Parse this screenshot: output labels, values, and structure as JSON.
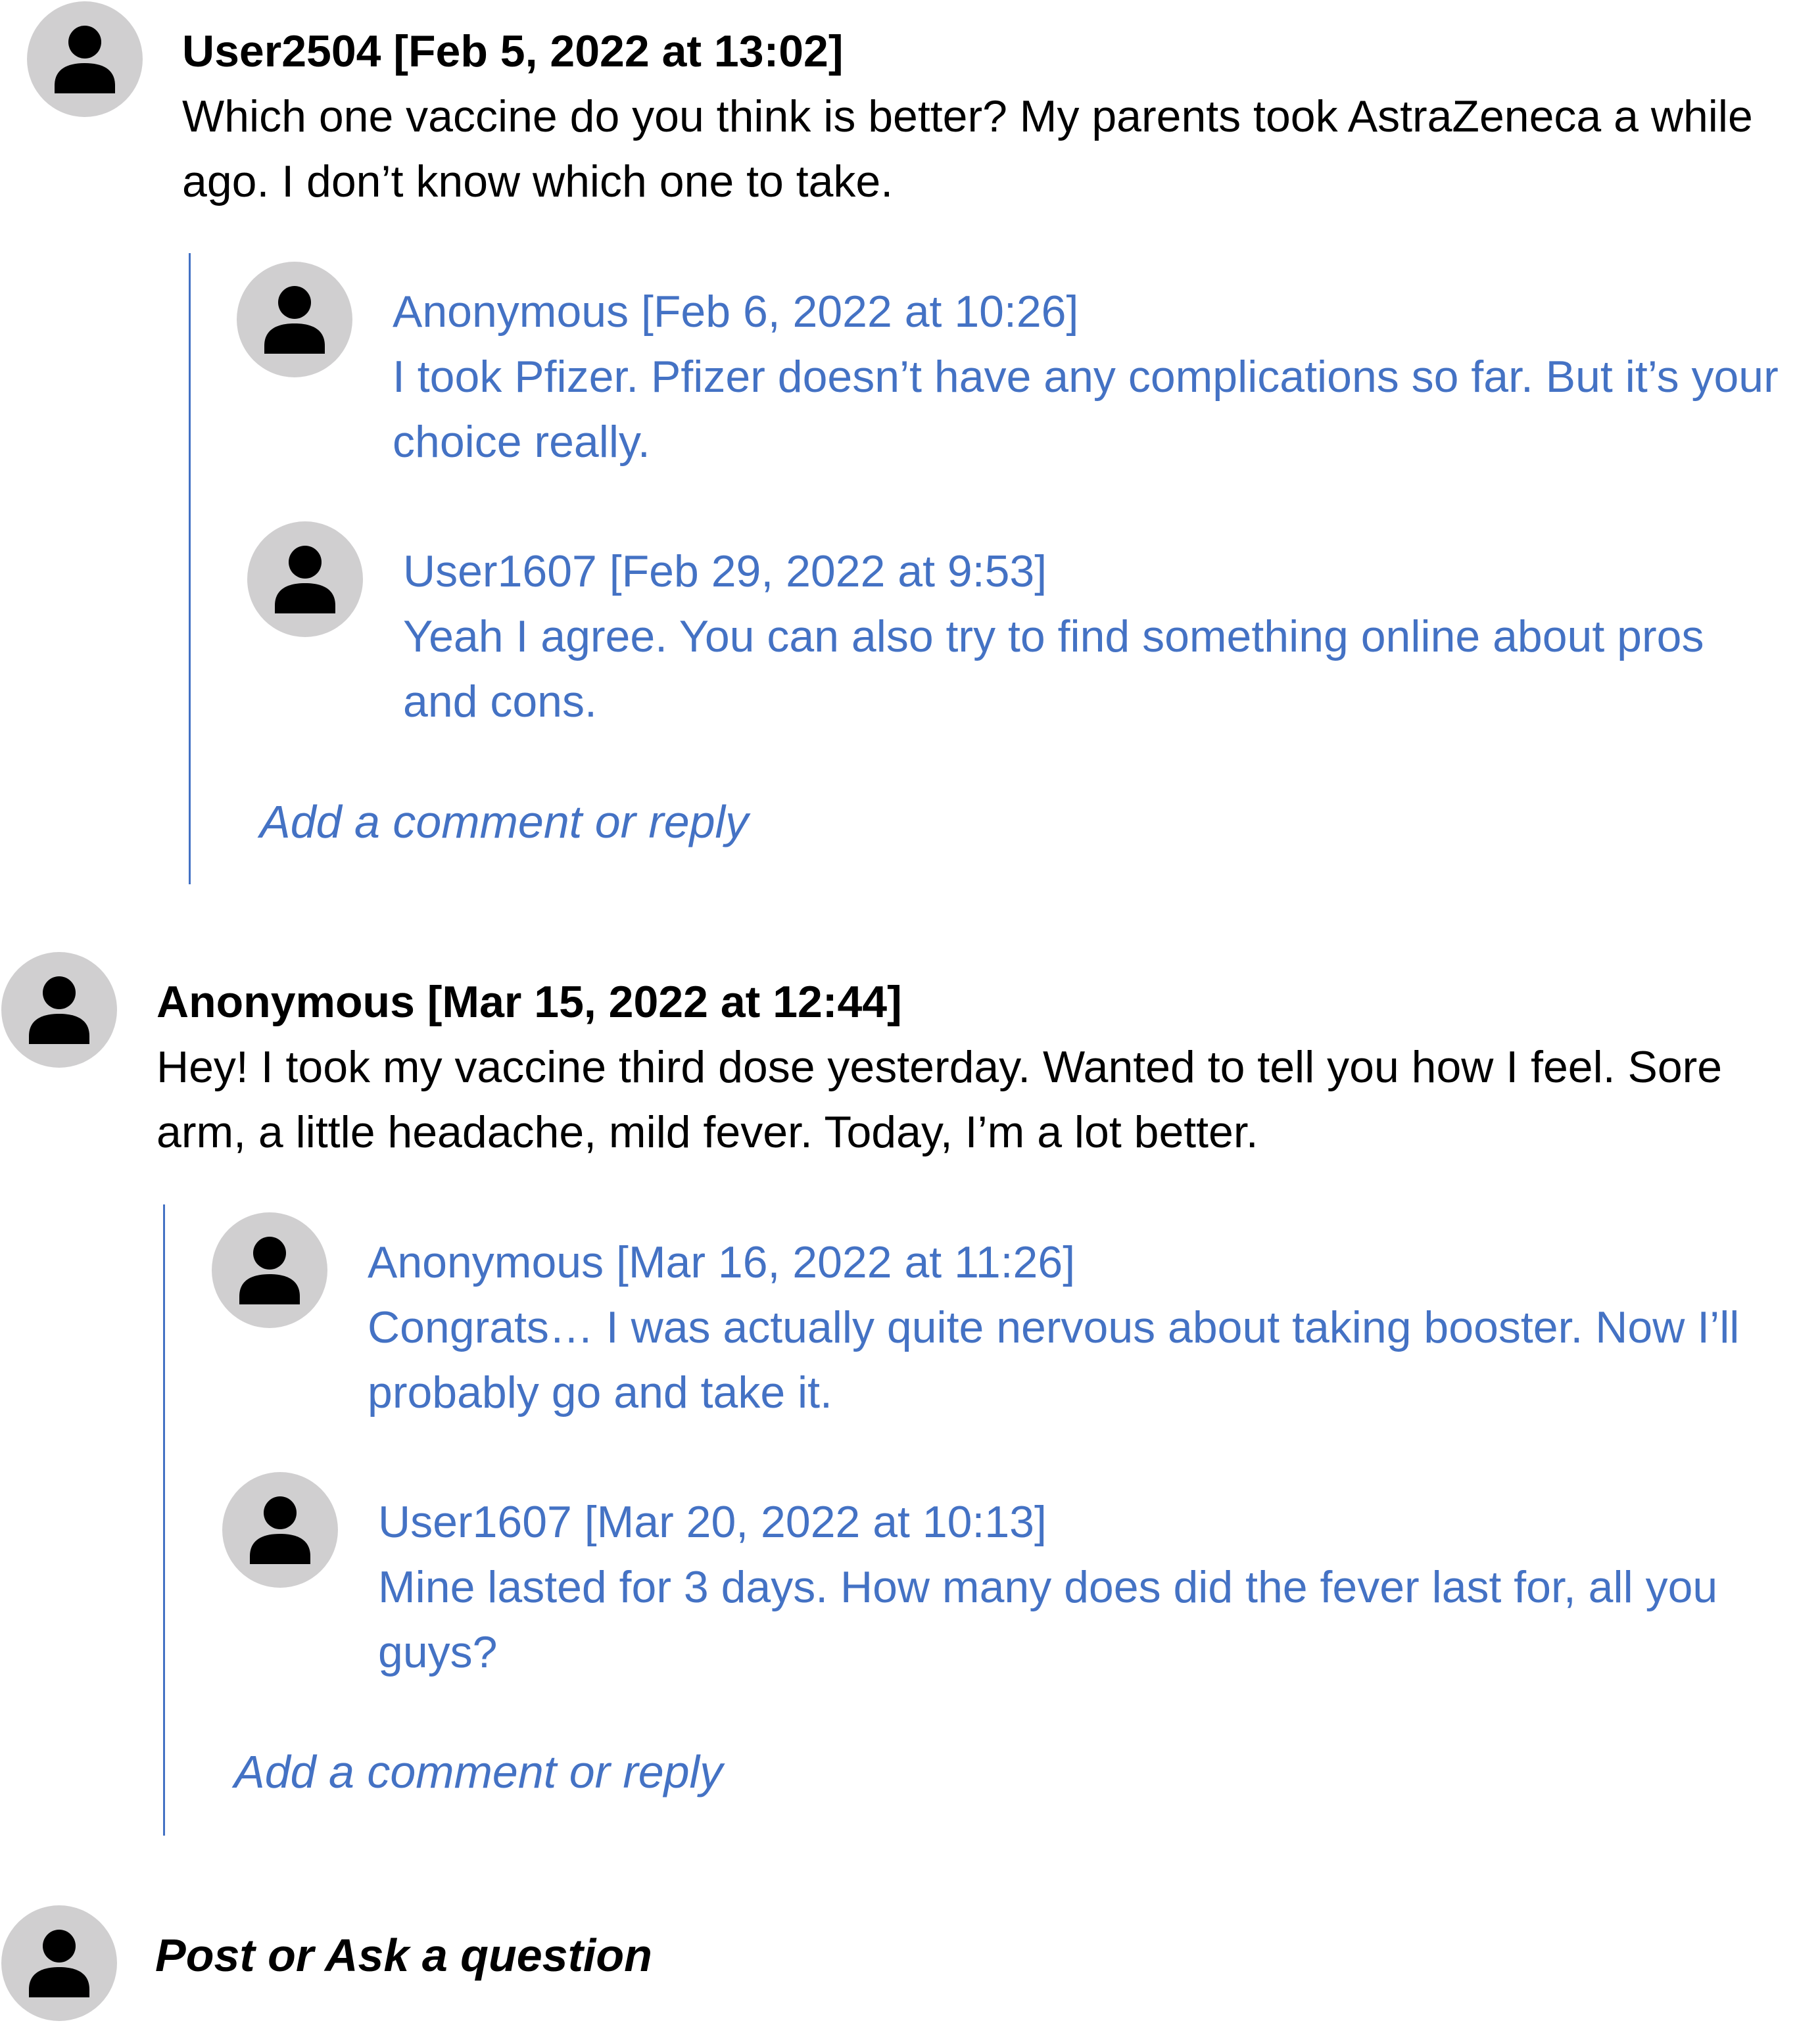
{
  "posts": [
    {
      "header": "User2504 [Feb 5, 2022 at 13:02]",
      "body": "Which one vaccine do you think is better? My parents took AstraZeneca a while ago. I don’t know which one to take.",
      "replies": [
        {
          "header": "Anonymous [Feb 6, 2022 at 10:26]",
          "body": "I took Pfizer. Pfizer doesn’t have any complications so far. But it’s your choice really."
        },
        {
          "header": "User1607 [Feb 29, 2022 at 9:53]",
          "body": "Yeah I agree. You can also try to find something online about pros and cons."
        }
      ],
      "add_reply_label": "Add a comment or reply"
    },
    {
      "header": "Anonymous [Mar 15, 2022 at 12:44]",
      "body": "Hey! I took my vaccine third dose yesterday. Wanted to tell you how I feel. Sore arm, a little headache, mild fever. Today, I’m a lot better.",
      "replies": [
        {
          "header": "Anonymous [Mar 16, 2022 at 11:26]",
          "body": "Congrats… I was actually quite nervous about taking booster. Now I’ll probably go and take it."
        },
        {
          "header": "User1607 [Mar 20, 2022 at 10:13]",
          "body": "Mine lasted for 3 days. How many does did the fever last for, all you guys?"
        }
      ],
      "add_reply_label": "Add a comment or reply"
    }
  ],
  "composer": {
    "label": "Post or Ask a question"
  },
  "colors": {
    "reply_text": "#4472c4",
    "thread_line": "#4472c4",
    "avatar_bg": "#d0cfd0",
    "avatar_icon": "#000000"
  },
  "icons": {
    "avatar": "person-icon"
  }
}
